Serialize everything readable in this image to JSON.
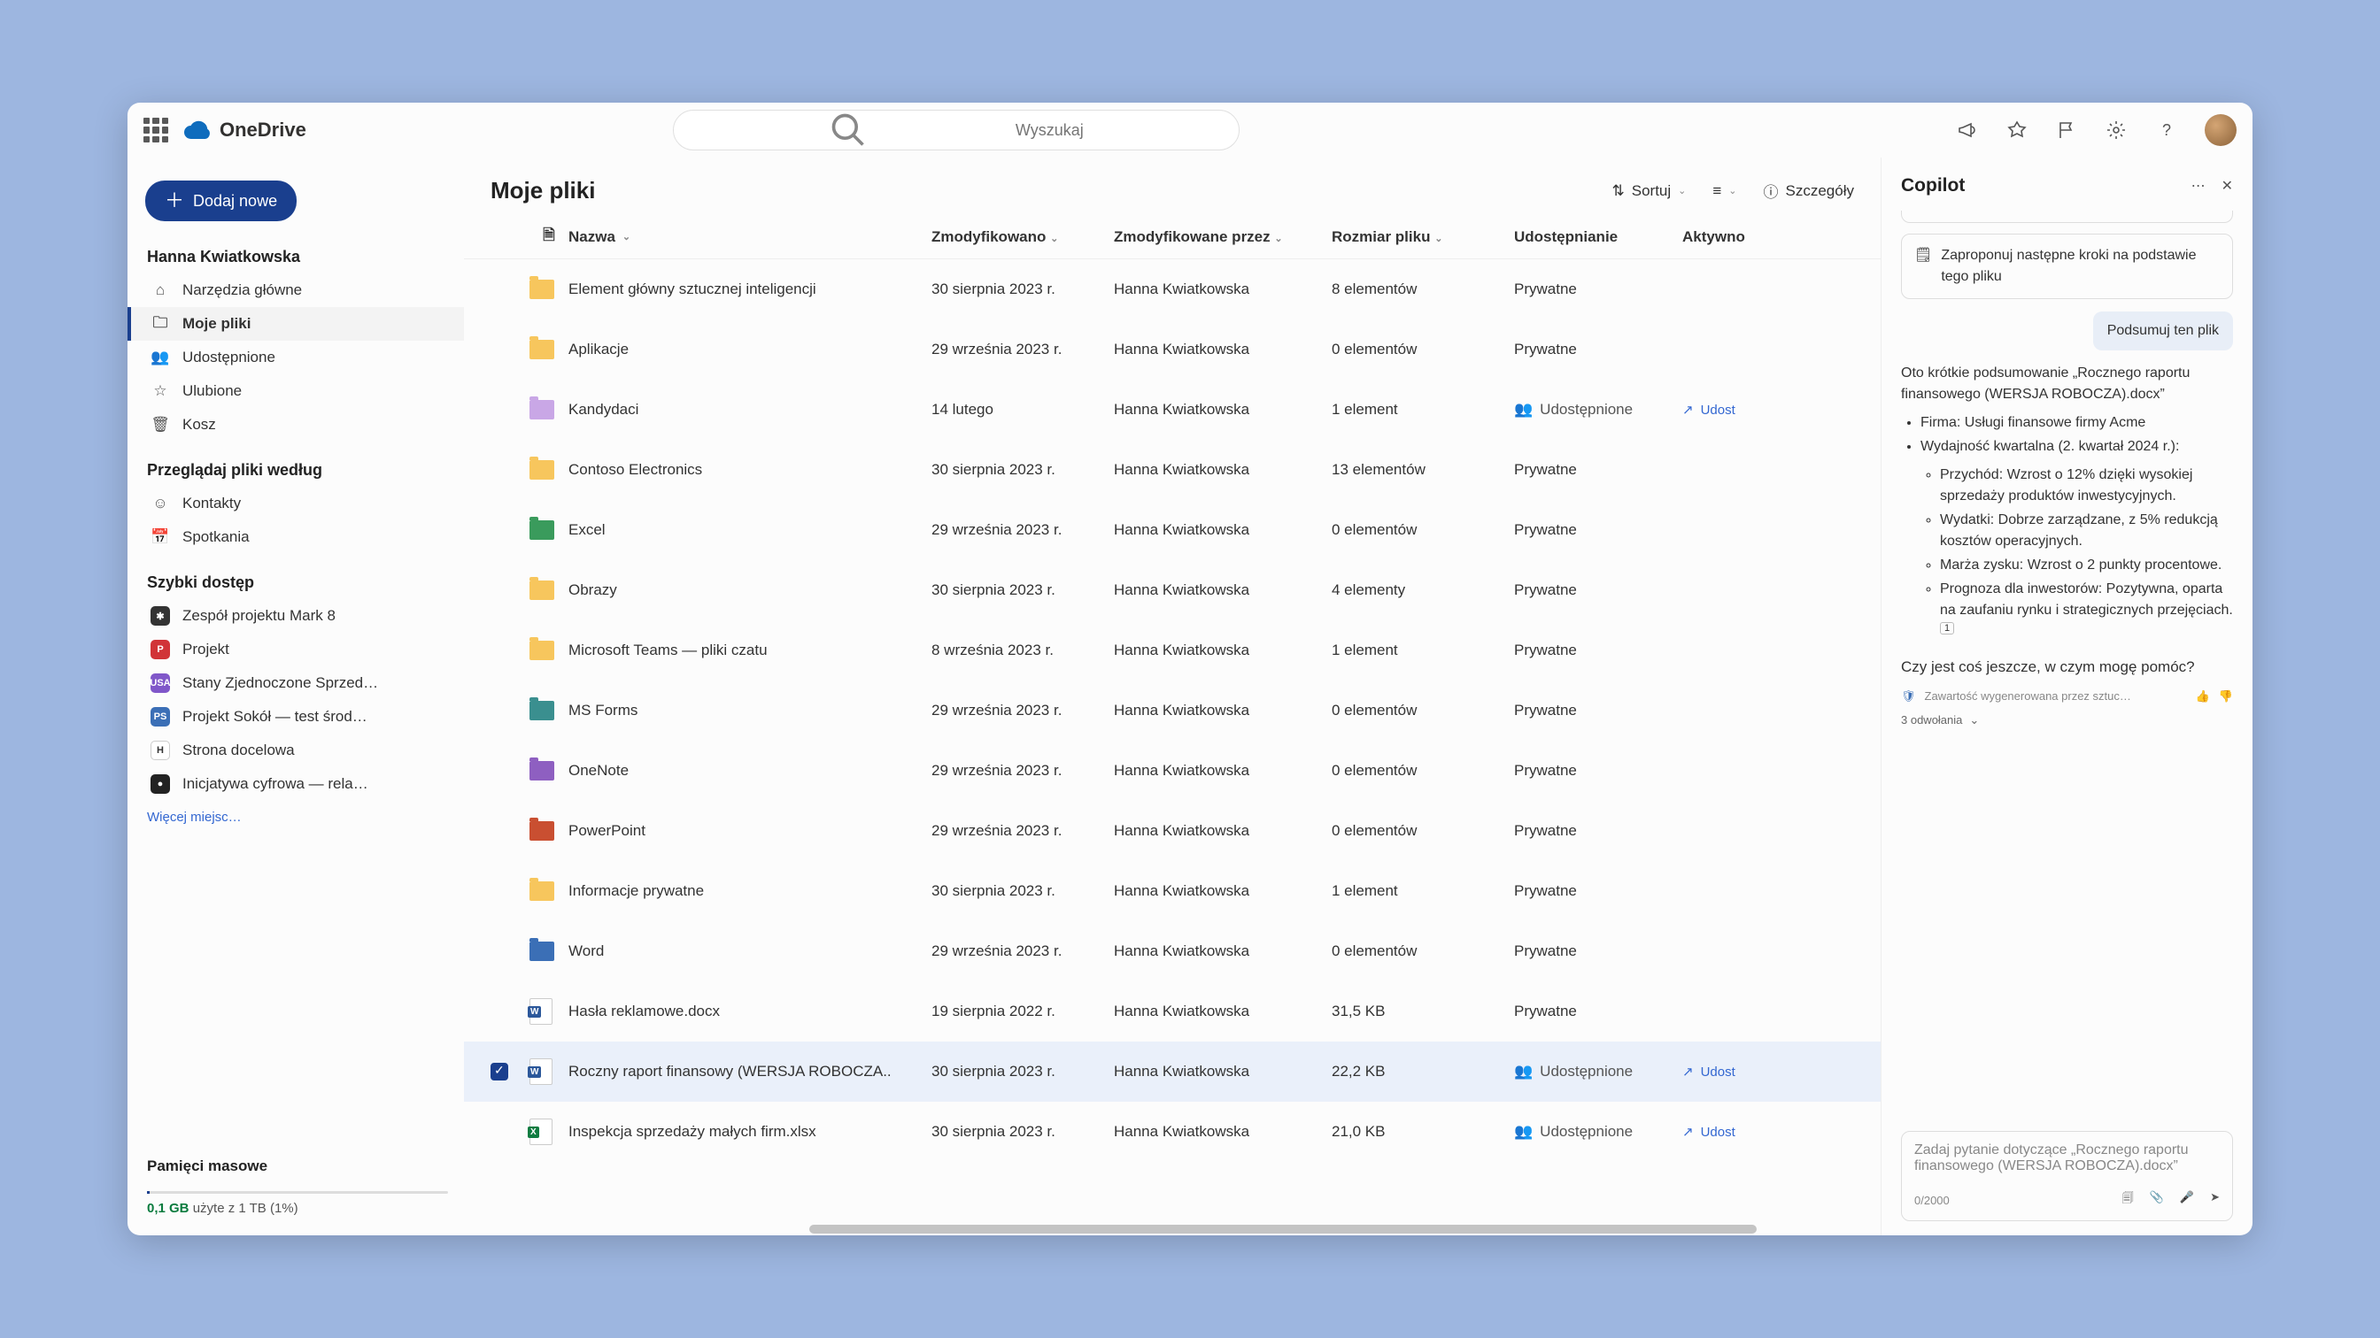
{
  "app": {
    "name": "OneDrive"
  },
  "search": {
    "placeholder": "Wyszukaj"
  },
  "newButton": "Dodaj nowe",
  "user": "Hanna Kwiatkowska",
  "nav": {
    "home": "Narzędzia główne",
    "myfiles": "Moje pliki",
    "shared": "Udostępnione",
    "favorites": "Ulubione",
    "recycle": "Kosz"
  },
  "browseHead": "Przeglądaj pliki według",
  "browse": {
    "contacts": "Kontakty",
    "meetings": "Spotkania"
  },
  "quickHead": "Szybki dostęp",
  "quick": [
    {
      "label": "Zespół projektu Mark 8",
      "color": "#333",
      "badgeText": "✱"
    },
    {
      "label": "Projekt",
      "color": "#d13438",
      "badgeText": "P"
    },
    {
      "label": "Stany Zjednoczone Sprzed…",
      "color": "#8057c9",
      "badgeText": "USA"
    },
    {
      "label": "Projekt Sokół — test środ…",
      "color": "#3b6fb6",
      "badgeText": "PS"
    },
    {
      "label": "Strona docelowa",
      "color": "#fff",
      "badgeText": "H"
    },
    {
      "label": "Inicjatywa cyfrowa — rela…",
      "color": "#222",
      "badgeText": "●"
    }
  ],
  "moreLink": "Więcej miejsc…",
  "storage": {
    "title": "Pamięci masowe",
    "usedColored": "0,1 GB",
    "text": " użyte z 1 TB (1%)"
  },
  "page": {
    "title": "Moje pliki",
    "sort": "Sortuj",
    "details": "Szczegóły"
  },
  "columns": {
    "name": "Nazwa",
    "modified": "Zmodyfikowano",
    "modifiedBy": "Zmodyfikowane przez",
    "size": "Rozmiar pliku",
    "sharing": "Udostępnianie",
    "activity": "Aktywno"
  },
  "sharedPeople": "Udostępnione",
  "privateLabel": "Prywatne",
  "shareActLabel": "Udost",
  "files": [
    {
      "name": "Element główny sztucznej inteligencji",
      "type": "folder",
      "color": "#f7c65d",
      "mod": "30 sierpnia 2023 r.",
      "by": "Hanna Kwiatkowska",
      "size": "8 elementów",
      "share": "private"
    },
    {
      "name": "Aplikacje",
      "type": "folder",
      "color": "#f7c65d",
      "mod": "29 września 2023 r.",
      "by": "Hanna Kwiatkowska",
      "size": "0 elementów",
      "share": "private"
    },
    {
      "name": "Kandydaci",
      "type": "folder",
      "color": "#c9a7e6",
      "mod": "14 lutego",
      "by": "Hanna Kwiatkowska",
      "size": "1 element",
      "share": "shared",
      "act": true
    },
    {
      "name": "Contoso Electronics",
      "type": "folder",
      "color": "#f7c65d",
      "mod": "30 sierpnia 2023 r.",
      "by": "Hanna Kwiatkowska",
      "size": "13 elementów",
      "share": "private"
    },
    {
      "name": "Excel",
      "type": "folder",
      "color": "#3a9b5c",
      "mod": "29 września 2023 r.",
      "by": "Hanna Kwiatkowska",
      "size": "0 elementów",
      "share": "private"
    },
    {
      "name": "Obrazy",
      "type": "folder",
      "color": "#f7c65d",
      "mod": "30 sierpnia 2023 r.",
      "by": "Hanna Kwiatkowska",
      "size": "4 elementy",
      "share": "private"
    },
    {
      "name": "Microsoft Teams — pliki czatu",
      "type": "folder",
      "color": "#f7c65d",
      "mod": "8 września 2023 r.",
      "by": "Hanna Kwiatkowska",
      "size": "1 element",
      "share": "private"
    },
    {
      "name": "MS Forms",
      "type": "folder",
      "color": "#3a8f8f",
      "mod": "29 września 2023 r.",
      "by": "Hanna Kwiatkowska",
      "size": "0 elementów",
      "share": "private"
    },
    {
      "name": "OneNote",
      "type": "folder",
      "color": "#8e5fc1",
      "mod": "29 września 2023 r.",
      "by": "Hanna Kwiatkowska",
      "size": "0 elementów",
      "share": "private"
    },
    {
      "name": "PowerPoint",
      "type": "folder",
      "color": "#c94f31",
      "mod": "29 września 2023 r.",
      "by": "Hanna Kwiatkowska",
      "size": "0 elementów",
      "share": "private"
    },
    {
      "name": "Informacje prywatne",
      "type": "folder",
      "color": "#f7c65d",
      "mod": "30 sierpnia 2023 r.",
      "by": "Hanna Kwiatkowska",
      "size": "1 element",
      "share": "private"
    },
    {
      "name": "Word",
      "type": "folder",
      "color": "#3b6fb6",
      "mod": "29 września 2023 r.",
      "by": "Hanna Kwiatkowska",
      "size": "0 elementów",
      "share": "private"
    },
    {
      "name": "Hasła reklamowe.docx",
      "type": "docx",
      "mod": "19 sierpnia 2022 r.",
      "by": "Hanna Kwiatkowska",
      "size": "31,5 KB",
      "share": "private"
    },
    {
      "name": "Roczny raport finansowy (WERSJA ROBOCZA..",
      "type": "docx",
      "mod": "30 sierpnia 2023 r.",
      "by": "Hanna Kwiatkowska",
      "size": "22,2 KB",
      "share": "shared",
      "act": true,
      "selected": true
    },
    {
      "name": "Inspekcja sprzedaży małych firm.xlsx",
      "type": "xlsx",
      "mod": "30 sierpnia 2023 r.",
      "by": "Hanna Kwiatkowska",
      "size": "21,0 KB",
      "share": "shared",
      "act": true
    }
  ],
  "copilot": {
    "title": "Copilot",
    "suggestBox": {
      "partial": ""
    },
    "suggest": "Zaproponuj następne kroki na podstawie tego pliku",
    "userMsg": "Podsumuj ten plik",
    "intro": "Oto krótkie podsumowanie „Rocznego raportu finansowego (WERSJA ROBOCZA).docx”",
    "b1": "Firma: Usługi finansowe firmy Acme",
    "b2": "Wydajność kwartalna (2. kwartał 2024 r.):",
    "s1": "Przychód: Wzrost o 12% dzięki wysokiej sprzedaży produktów inwestycyjnych.",
    "s2": "Wydatki: Dobrze zarządzane, z 5% redukcją kosztów operacyjnych.",
    "s3": "Marża zysku: Wzrost o 2 punkty procentowe.",
    "s4": "Prognoza dla inwestorów: Pozytywna, oparta na zaufaniu rynku i strategicznych przejęciach.",
    "ref1": "1",
    "follow": "Czy jest coś jeszcze, w czym mogę pomóc?",
    "aiNote": "Zawartość wygenerowana przez sztuc…",
    "refs": "3 odwołania",
    "inputPlaceholder": "Zadaj pytanie dotyczące „Rocznego raportu finansowego (WERSJA ROBOCZA).docx”",
    "counter": "0/2000"
  }
}
